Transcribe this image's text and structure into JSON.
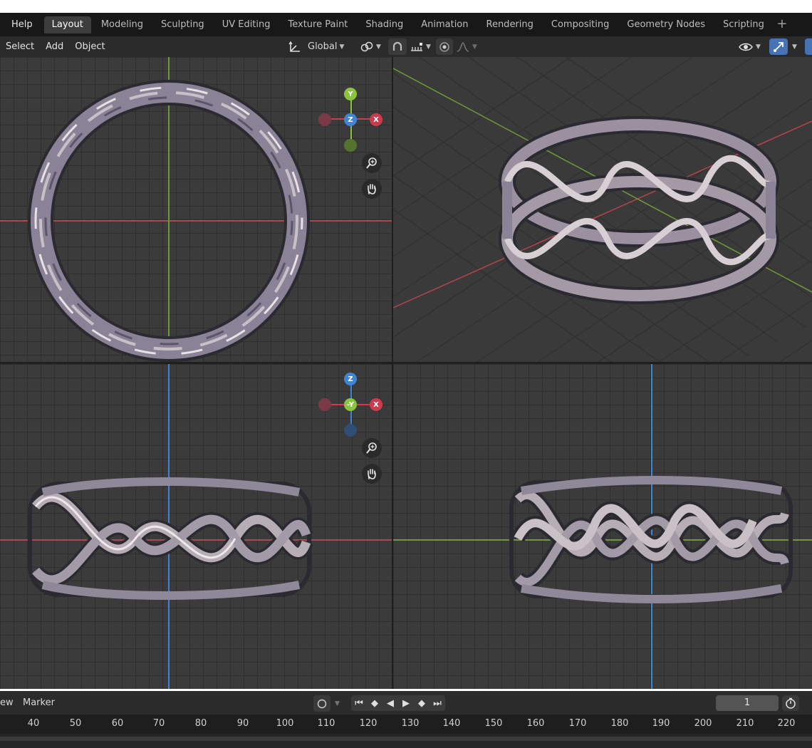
{
  "topbar": {
    "help": "Help",
    "tabs": [
      {
        "label": "Layout",
        "active": true
      },
      {
        "label": "Modeling"
      },
      {
        "label": "Sculpting"
      },
      {
        "label": "UV Editing"
      },
      {
        "label": "Texture Paint"
      },
      {
        "label": "Shading"
      },
      {
        "label": "Animation"
      },
      {
        "label": "Rendering"
      },
      {
        "label": "Compositing"
      },
      {
        "label": "Geometry Nodes"
      },
      {
        "label": "Scripting"
      }
    ],
    "add_tab": "+"
  },
  "header": {
    "menus": [
      "Select",
      "Add",
      "Object"
    ],
    "transform_orientation": "Global"
  },
  "gizmo_top": {
    "y": "Y",
    "z": "Z",
    "x": "X"
  },
  "gizmo_front": {
    "z": "Z",
    "y": "-Y",
    "x": "X"
  },
  "timeline": {
    "menu_view_partial": "ew",
    "menu_marker": "Marker",
    "current_frame": "1",
    "ticks": [
      "40",
      "50",
      "60",
      "70",
      "80",
      "90",
      "100",
      "110",
      "120",
      "130",
      "140",
      "150",
      "160",
      "170",
      "180",
      "190",
      "200",
      "210",
      "220"
    ]
  },
  "colors": {
    "x_axis": "#d03a4e",
    "y_axis": "#8ac43c",
    "z_axis": "#3f85d6",
    "accent": "#4772b3"
  }
}
